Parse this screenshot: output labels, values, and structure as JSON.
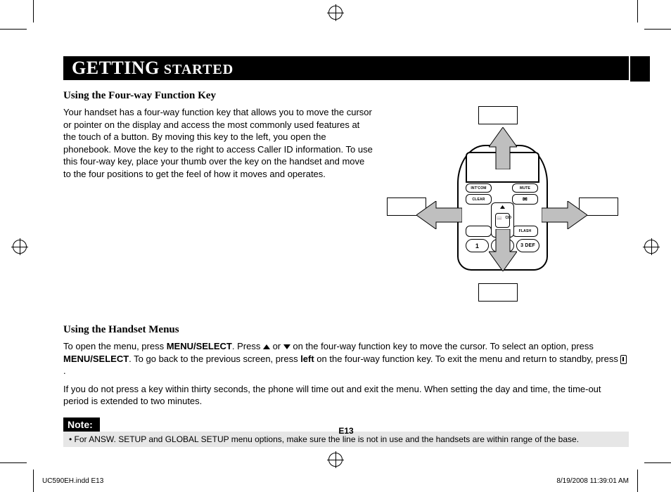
{
  "title": {
    "big": "GETTING",
    "small": " STARTED"
  },
  "section1": {
    "heading": "Using the Four-way Function Key",
    "body": "Your handset has a four-way function key that allows you to move the cursor or pointer on the display and access the most commonly used features at the touch of a button. By moving this key to the left, you open the phonebook. Move the key to the right to access Caller ID information. To use this four-way key, place your thumb over the key on the handset and move to the four positions to get the feel of how it moves and operates."
  },
  "illus": {
    "intcom": "INT'COM",
    "mute": "MUTE",
    "clear": "CLEAR",
    "flash": "FLASH",
    "k1": "1",
    "k3": "3 DEF",
    "cid": "CID"
  },
  "section2": {
    "heading": "Using the Handset Menus",
    "p1a": "To open the menu, press ",
    "menu_select": "MENU/SELECT",
    "p1b": ". Press ",
    "p1c": " or ",
    "p1d": " on the four-way function key to move the cursor. To select an option, press ",
    "p1e": ". To go back to the previous screen, press ",
    "left_word": "left",
    "p1f": " on the four-way function key. To exit the menu and return to standby, press ",
    "p1g": ".",
    "p2": "If you do not press a key within thirty seconds, the phone will time out and exit the menu. When setting the day and time, the time-out period is extended to two minutes."
  },
  "note": {
    "label": "Note:",
    "body": "• For ANSW. SETUP and GLOBAL SETUP menu options, make sure the line is not in use and the handsets are within range of the base."
  },
  "page_num": "E13",
  "footer": {
    "file": "UC590EH.indd   E13",
    "date": "8/19/2008   11:39:01 AM"
  }
}
